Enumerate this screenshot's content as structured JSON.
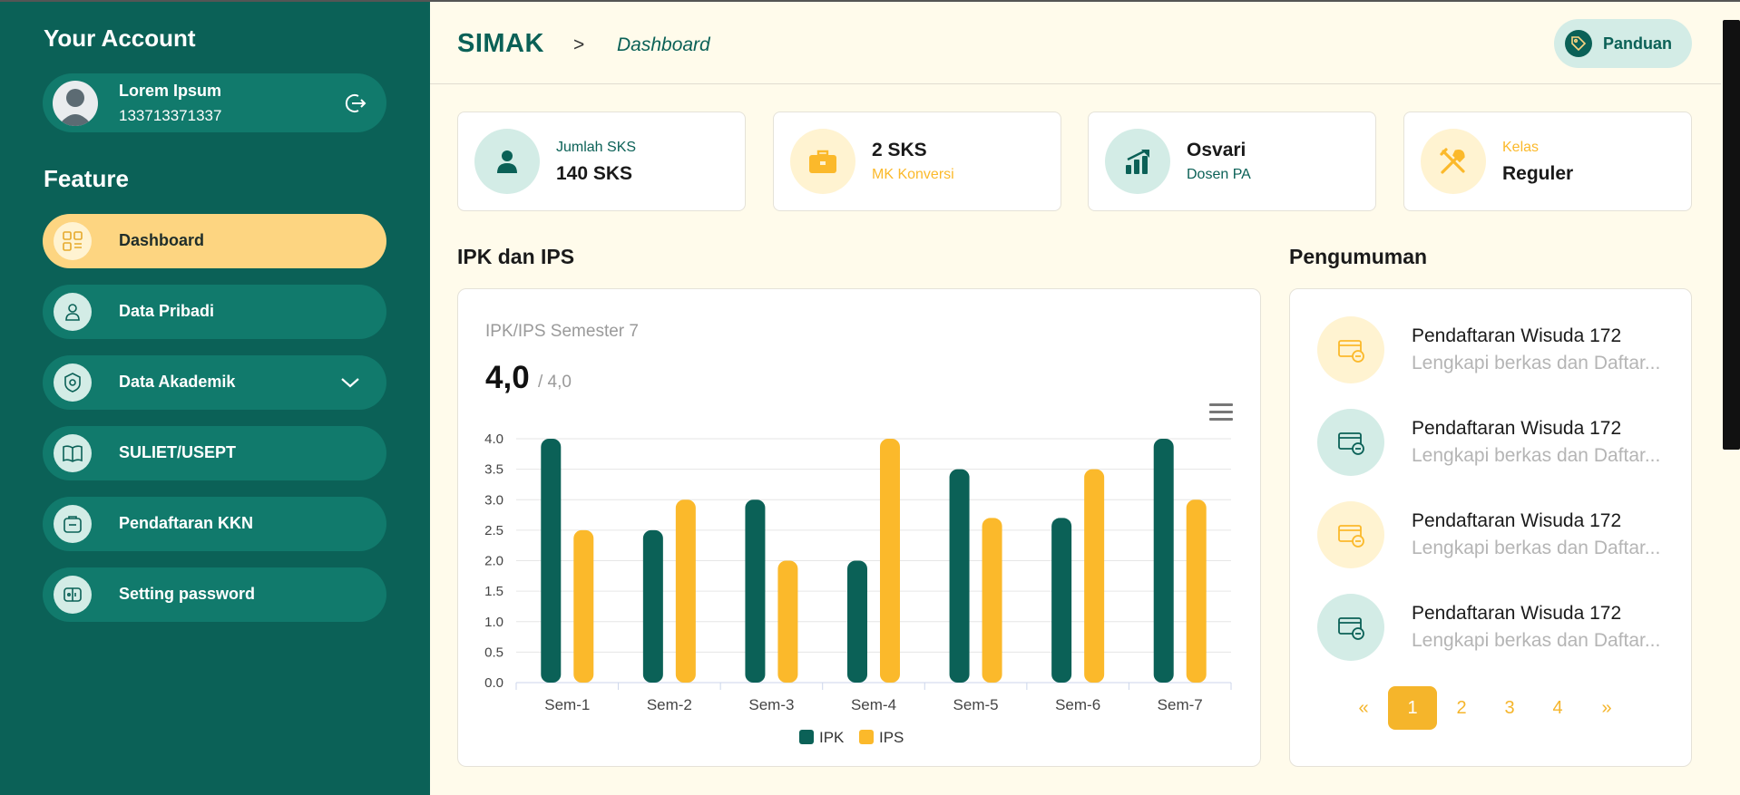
{
  "sidebar": {
    "account_title": "Your Account",
    "user": {
      "name": "Lorem Ipsum",
      "id": "133713371337"
    },
    "feature_title": "Feature",
    "items": [
      {
        "label": "Dashboard",
        "icon": "dashboard-icon",
        "active": true
      },
      {
        "label": "Data Pribadi",
        "icon": "user-icon"
      },
      {
        "label": "Data Akademik",
        "icon": "academic-lock-icon",
        "has_dropdown": true
      },
      {
        "label": "SULIET/USEPT",
        "icon": "book-icon"
      },
      {
        "label": "Pendaftaran KKN",
        "icon": "bag-icon"
      },
      {
        "label": "Setting password",
        "icon": "password-icon"
      }
    ]
  },
  "header": {
    "brand": "SIMAK",
    "separator": ">",
    "breadcrumb": "Dashboard",
    "guide_label": "Panduan"
  },
  "stats": [
    {
      "small": "Jumlah SKS",
      "big": "140 SKS",
      "icon": "user-icon"
    },
    {
      "big": "2 SKS",
      "small": "MK Konversi",
      "icon": "briefcase-icon"
    },
    {
      "big": "Osvari",
      "small": "Dosen PA",
      "icon": "chart-up-icon"
    },
    {
      "small": "Kelas",
      "big": "Reguler",
      "icon": "tools-icon"
    }
  ],
  "ipk_section": {
    "title": "IPK dan IPS",
    "subtitle": "IPK/IPS Semester 7",
    "value": "4,0",
    "max": "/ 4,0"
  },
  "chart_data": {
    "type": "bar",
    "categories": [
      "Sem-1",
      "Sem-2",
      "Sem-3",
      "Sem-4",
      "Sem-5",
      "Sem-6",
      "Sem-7"
    ],
    "series": [
      {
        "name": "IPK",
        "color": "#0b6157",
        "values": [
          4.0,
          2.5,
          3.0,
          2.0,
          3.5,
          2.7,
          4.0
        ]
      },
      {
        "name": "IPS",
        "color": "#fbb92b",
        "values": [
          2.5,
          3.0,
          2.0,
          4.0,
          2.7,
          3.5,
          3.0
        ]
      }
    ],
    "yticks": [
      "0.0",
      "0.5",
      "1.0",
      "1.5",
      "2.0",
      "2.5",
      "3.0",
      "3.5",
      "4.0"
    ],
    "ylim": [
      0,
      4
    ],
    "legend": "bottom",
    "grid": true
  },
  "announcements": {
    "title": "Pengumuman",
    "items": [
      {
        "title": "Pendaftaran Wisuda 172",
        "desc": "Lengkapi berkas dan Daftar...",
        "color": "yellow"
      },
      {
        "title": "Pendaftaran Wisuda 172",
        "desc": "Lengkapi berkas dan Daftar...",
        "color": "green"
      },
      {
        "title": "Pendaftaran Wisuda 172",
        "desc": "Lengkapi berkas dan Daftar...",
        "color": "yellow"
      },
      {
        "title": "Pendaftaran Wisuda 172",
        "desc": "Lengkapi berkas dan Daftar...",
        "color": "green"
      }
    ],
    "pagination": {
      "prev": "«",
      "pages": [
        "1",
        "2",
        "3",
        "4"
      ],
      "next": "»",
      "current": "1"
    }
  },
  "colors": {
    "primary": "#0b6157",
    "accent": "#fbb92b",
    "active_nav": "#fdd581",
    "background": "#fffbeb"
  }
}
